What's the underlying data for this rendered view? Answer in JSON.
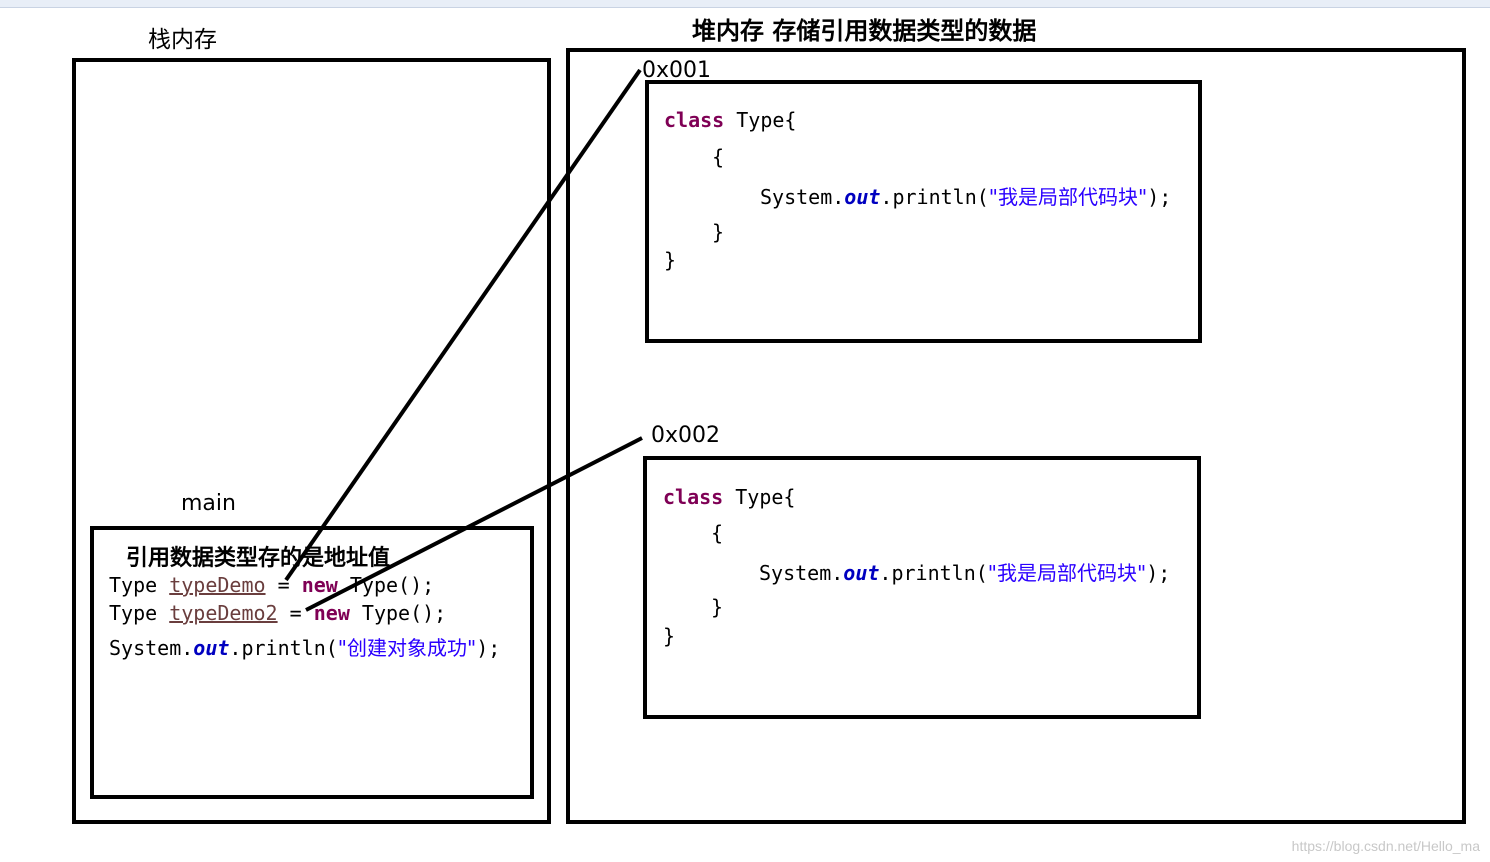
{
  "stack": {
    "title": "栈内存",
    "main_label": "main",
    "note": "引用数据类型存的是地址值",
    "code": {
      "line1": {
        "type": "Type",
        "var": "typeDemo",
        "eq": "=",
        "kw": "new",
        "rest": "Type();"
      },
      "line2": {
        "type": "Type",
        "var": "typeDemo2",
        "eq": "=",
        "kw": "new",
        "rest": "Type();"
      },
      "line3": {
        "sys": "System.",
        "field": "out",
        "call": ".println(",
        "str": "\"创建对象成功\"",
        "end": ");"
      }
    }
  },
  "heap": {
    "title": "堆内存 存储引用数据类型的数据",
    "objects": [
      {
        "address": "0x001",
        "line1_kw": "class",
        "line1_rest": "Type{",
        "open": "{",
        "sys": "System.",
        "field": "out",
        "call": ".println(",
        "str": "\"我是局部代码块\"",
        "end": ");",
        "close_inner": "}",
        "close_outer": "}"
      },
      {
        "address": "0x002",
        "line1_kw": "class",
        "line1_rest": "Type{",
        "open": "{",
        "sys": "System.",
        "field": "out",
        "call": ".println(",
        "str": "\"我是局部代码块\"",
        "end": ");",
        "close_inner": "}",
        "close_outer": "}"
      }
    ]
  },
  "watermark": "https://blog.csdn.net/Hello_ma",
  "colors": {
    "keyword": "#7f0055",
    "static_field": "#0000c0",
    "string": "#2a00ff",
    "variable": "#6a3e3e",
    "border": "#000000"
  }
}
